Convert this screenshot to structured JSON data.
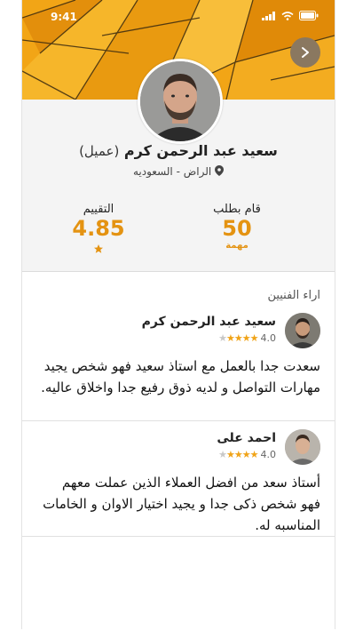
{
  "status_bar": {
    "time": "9:41"
  },
  "profile": {
    "name": "سعيد عبد الرحمن كرم",
    "role_tag": "(عميل)",
    "location": "الراض - السعوديه"
  },
  "stats": {
    "rating": {
      "label": "التقييم",
      "value": "4.85"
    },
    "requests": {
      "label": "قام بطلب",
      "value": "50",
      "unit": "مهمة"
    }
  },
  "reviews_section": {
    "title": "اراء الفنيين",
    "reviews": [
      {
        "name": "سعيد عبد الرحمن كرم",
        "rating": "4.0",
        "stars": 4,
        "text": "سعدت جدا بالعمل مع استاذ سعيد فهو شخص يجيد مهارات التواصل و لديه ذوق رفيع جدا واخلاق عاليه."
      },
      {
        "name": "احمد على",
        "rating": "4.0",
        "stars": 4,
        "text": "أستاذ سعد من افضل العملاء الذين عملت معهم فهو شخص ذكى جدا و يجيد اختيار الاوان و الخامات المناسبه له."
      }
    ]
  },
  "colors": {
    "accent": "#f0a317",
    "value_orange": "#e49312"
  }
}
